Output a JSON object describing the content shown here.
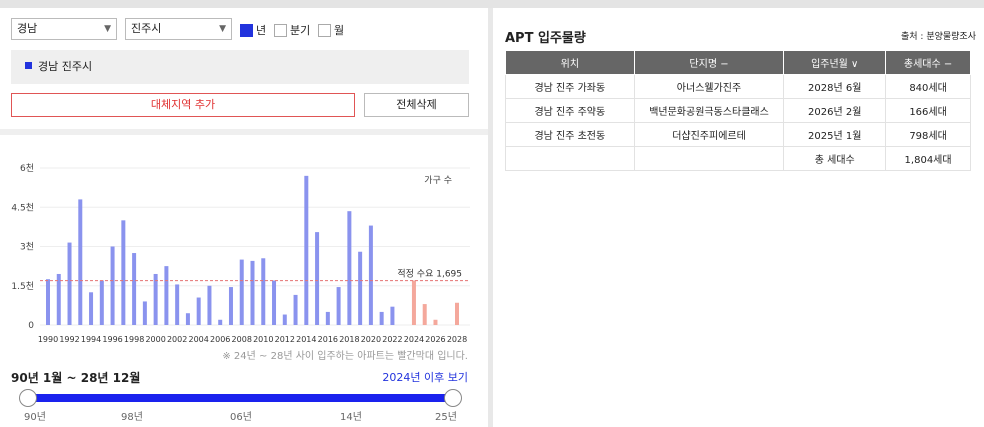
{
  "filters": {
    "province": "경남",
    "city": "진주시",
    "period_options": [
      {
        "label": "년",
        "checked": true
      },
      {
        "label": "분기",
        "checked": false
      },
      {
        "label": "월",
        "checked": false
      }
    ]
  },
  "selected_region": "경남 진주시",
  "buttons": {
    "add_region": "대체지역 추가",
    "delete_all": "전체삭제"
  },
  "chart_data": {
    "type": "bar",
    "legend": "가구 수",
    "yticks": [
      "0",
      "1.5천",
      "3천",
      "4.5천",
      "6천"
    ],
    "ylim": [
      0,
      6000
    ],
    "xticks": [
      "1990",
      "1992",
      "1994",
      "1996",
      "1998",
      "2000",
      "2002",
      "2004",
      "2006",
      "2008",
      "2010",
      "2012",
      "2014",
      "2016",
      "2018",
      "2020",
      "2022",
      "2024",
      "2026",
      "2028"
    ],
    "years": [
      1990,
      1991,
      1992,
      1993,
      1994,
      1995,
      1996,
      1997,
      1998,
      1999,
      2000,
      2001,
      2002,
      2003,
      2004,
      2005,
      2006,
      2007,
      2008,
      2009,
      2010,
      2011,
      2012,
      2013,
      2014,
      2015,
      2016,
      2017,
      2018,
      2019,
      2020,
      2021,
      2022,
      2023,
      2024,
      2025,
      2026,
      2027,
      2028
    ],
    "values": [
      1750,
      1950,
      3150,
      4800,
      1250,
      1700,
      3000,
      4000,
      2750,
      900,
      1950,
      2250,
      1550,
      450,
      1050,
      1500,
      200,
      1450,
      2500,
      2450,
      2550,
      1700,
      400,
      1150,
      5700,
      3550,
      500,
      1450,
      4350,
      2800,
      3800,
      500,
      700,
      0,
      1700,
      800,
      200,
      0,
      850
    ],
    "future_from_year": 2024,
    "reference_line": {
      "label": "적정 수요 1,695",
      "value": 1695
    },
    "colors": {
      "past": "#8a93ee",
      "future": "#f4a89c",
      "reference": "#e57373"
    }
  },
  "chart_note": "※ 24년 ~ 28년 사이 입주하는 아파트는 빨간막대 입니다.",
  "range_label": "90년 1월 ~ 28년 12월",
  "after_link": "2024년 이후 보기",
  "slider": {
    "ticks": [
      "90년",
      "98년",
      "06년",
      "14년",
      "25년"
    ]
  },
  "panel": {
    "title": "APT 입주물량",
    "source": "출처 : 분양물량조사",
    "headers": [
      "위치",
      "단지명 −",
      "입주년월 ∨",
      "총세대수 −"
    ],
    "rows": [
      [
        "경남 진주 가좌동",
        "아너스웰가진주",
        "2028년 6월",
        "840세대"
      ],
      [
        "경남 진주 주약동",
        "백년문화공원극동스타클래스",
        "2026년 2월",
        "166세대"
      ],
      [
        "경남 진주 초전동",
        "더샵진주피에르테",
        "2025년 1월",
        "798세대"
      ]
    ],
    "total_label": "총 세대수",
    "total_value": "1,804세대"
  }
}
